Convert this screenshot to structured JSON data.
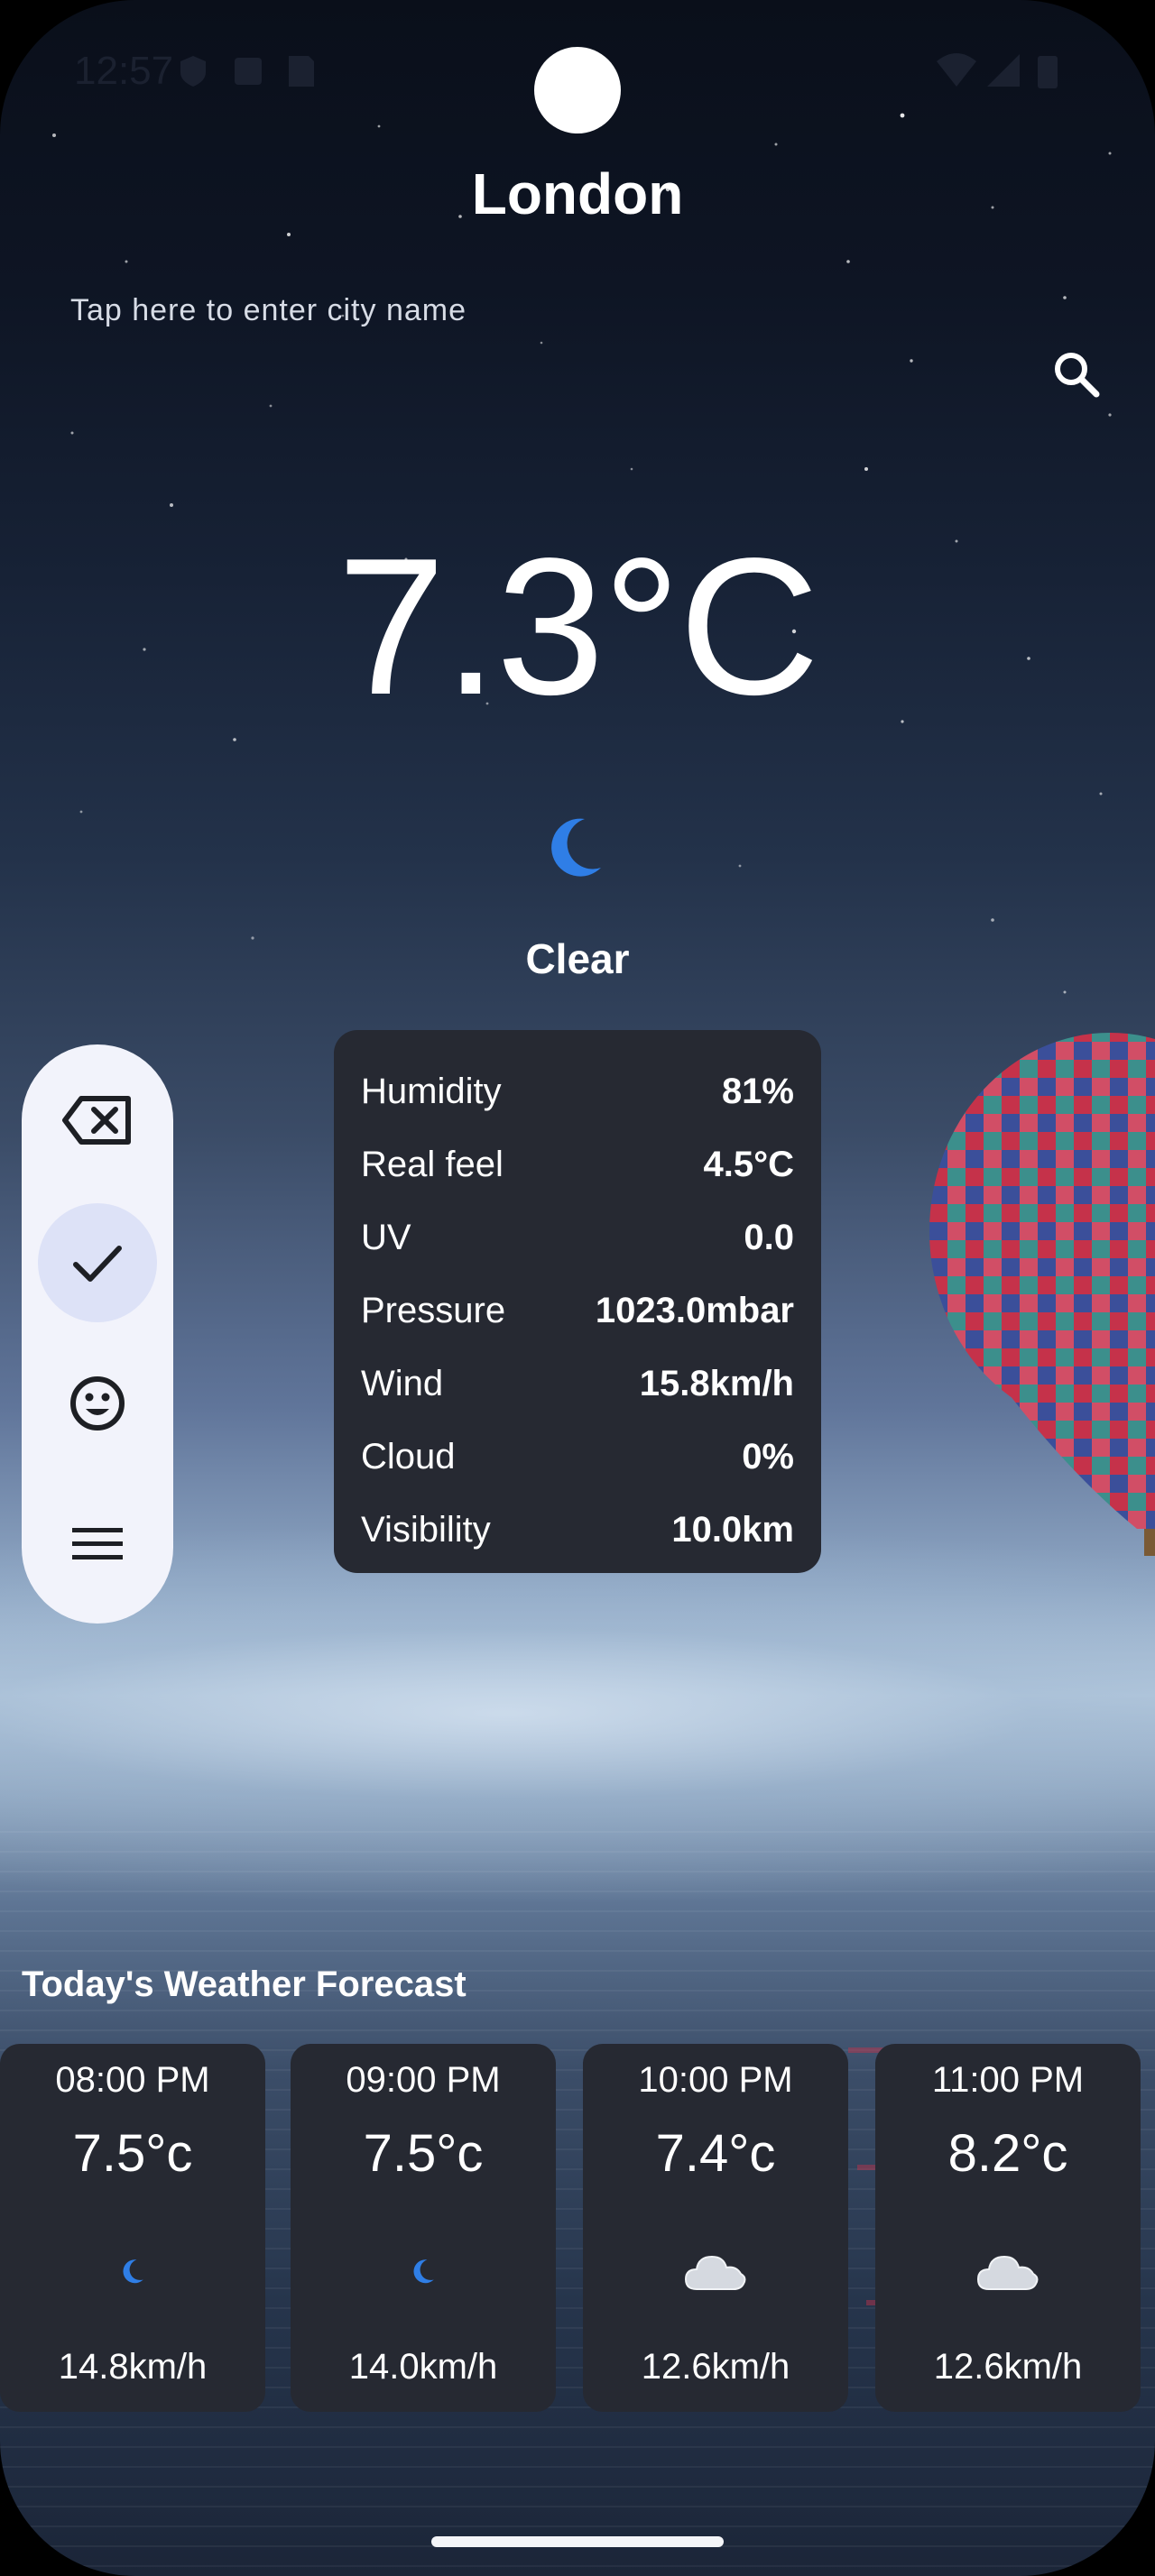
{
  "status_bar": {
    "time": "12:57"
  },
  "city": {
    "name": "London",
    "input_placeholder": "Tap here to enter city name",
    "input_value": ""
  },
  "current": {
    "temperature": "7.3°C",
    "condition": "Clear",
    "condition_icon": "crescent-moon-icon"
  },
  "details": [
    {
      "label": "Humidity",
      "value": "81%"
    },
    {
      "label": "Real feel",
      "value": "4.5°C"
    },
    {
      "label": "UV",
      "value": "0.0"
    },
    {
      "label": "Pressure",
      "value": "1023.0mbar"
    },
    {
      "label": "Wind",
      "value": "15.8km/h"
    },
    {
      "label": "Cloud",
      "value": "0%"
    },
    {
      "label": "Visibility",
      "value": "10.0km"
    }
  ],
  "keyboard_toolbar": {
    "buttons": [
      "backspace-icon",
      "check-icon",
      "emoji-icon",
      "menu-icon"
    ],
    "selected": "check-icon"
  },
  "forecast": {
    "title": "Today's Weather Forecast",
    "items": [
      {
        "time": "08:00 PM",
        "temp": "7.5°c",
        "icon": "crescent-moon-icon",
        "wind": "14.8km/h"
      },
      {
        "time": "09:00 PM",
        "temp": "7.5°c",
        "icon": "crescent-moon-icon",
        "wind": "14.0km/h"
      },
      {
        "time": "10:00 PM",
        "temp": "7.4°c",
        "icon": "cloud-icon",
        "wind": "12.6km/h"
      },
      {
        "time": "11:00 PM",
        "temp": "8.2°c",
        "icon": "cloud-icon",
        "wind": "12.6km/h"
      }
    ]
  },
  "colors": {
    "card_background": "#262932",
    "text": "#ffffff",
    "moon_icon": "#2f7ee6",
    "toolbar_background": "#f2f3fb",
    "toolbar_selected": "#dde2f7"
  }
}
